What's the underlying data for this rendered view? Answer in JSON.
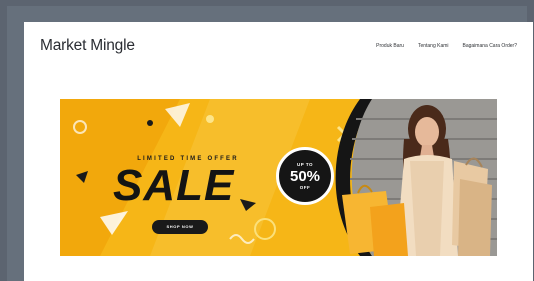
{
  "navbar": {
    "brand": "Market Mingle",
    "links": [
      "Produk Baru",
      "Tentang Kami",
      "Bagaimana Cara Order?"
    ]
  },
  "banner": {
    "offer": "LIMITED TIME OFFER",
    "headline": "SALE",
    "badge_top": "UP TO",
    "badge_value": "50%",
    "badge_bottom": "OFF",
    "button": "SHOP NOW"
  },
  "colors": {
    "brand_yellow": "#f6b617",
    "dark": "#151515",
    "frame": "#5c6470"
  }
}
